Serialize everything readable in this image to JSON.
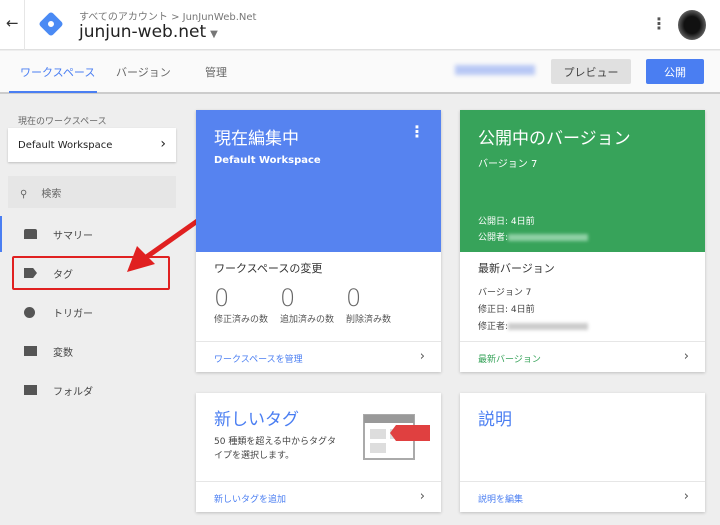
{
  "header": {
    "back_icon": "arrow-left",
    "breadcrumb": "すべてのアカウント > JunJunWeb.Net",
    "container_name": "junjun-web.net"
  },
  "tabs": [
    {
      "label": "ワークスペース"
    },
    {
      "label": "バージョン"
    },
    {
      "label": "管理"
    }
  ],
  "actions": {
    "preview": "プレビュー",
    "publish": "公開"
  },
  "sidebar": {
    "current_workspace_label": "現在のワークスペース",
    "workspace": "Default Workspace",
    "search_placeholder": "検索",
    "items": [
      {
        "label": "サマリー"
      },
      {
        "label": "タグ"
      },
      {
        "label": "トリガー"
      },
      {
        "label": "変数"
      },
      {
        "label": "フォルダ"
      }
    ]
  },
  "editing_card": {
    "title": "現在編集中",
    "workspace": "Default Workspace",
    "changes_title": "ワークスペースの変更",
    "stats": [
      {
        "value": "0",
        "label": "修正済みの数"
      },
      {
        "value": "0",
        "label": "追加済みの数"
      },
      {
        "value": "0",
        "label": "削除済み数"
      }
    ],
    "link": "ワークスペースを管理"
  },
  "published_card": {
    "title": "公開中のバージョン",
    "version": "バージョン 7",
    "published_date": "公開日: 4日前",
    "published_by": "公開者:",
    "latest_title": "最新バージョン",
    "latest_version": "バージョン 7",
    "modified_date": "修正日: 4日前",
    "modified_by": "修正者:",
    "link": "最新バージョン"
  },
  "new_tag_card": {
    "title": "新しいタグ",
    "description": "50 種類を超える中からタグタイプを選択します。",
    "link": "新しいタグを追加"
  },
  "description_card": {
    "title": "説明",
    "link": "説明を編集"
  },
  "colors": {
    "blue": "#5683f0",
    "green": "#37a35a",
    "accent": "#4a7ef2",
    "highlight": "#e02020"
  }
}
